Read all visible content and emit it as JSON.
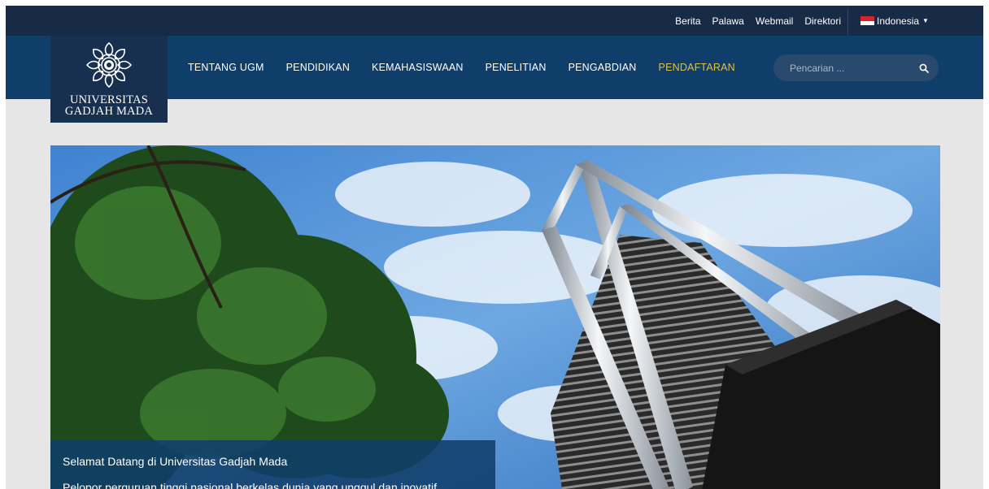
{
  "topbar": {
    "links": [
      "Berita",
      "Palawa",
      "Webmail",
      "Direktori"
    ],
    "language": "Indonesia"
  },
  "logo": {
    "line1": "UNIVERSITAS",
    "line2": "GADJAH MADA"
  },
  "nav": {
    "items": [
      "TENTANG UGM",
      "PENDIDIKAN",
      "KEMAHASISWAAN",
      "PENELITIAN",
      "PENGABDIAN",
      "PENDAFTARAN"
    ],
    "active_index": 5
  },
  "search": {
    "placeholder": "Pencarian ..."
  },
  "hero": {
    "title": "Selamat Datang di Universitas Gadjah Mada",
    "subtitle": "Pelopor perguruan tinggi nasional berkelas dunia yang unggul dan inovatif"
  },
  "colors": {
    "topbar": "#172b47",
    "navbar": "#0f3e6a",
    "logo_box": "#18304f",
    "active_nav": "#e2c242",
    "page_bg": "#e6e6e6"
  }
}
